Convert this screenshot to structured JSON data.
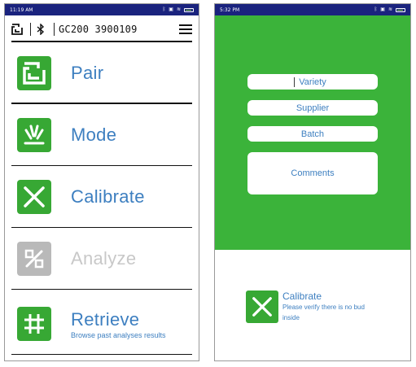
{
  "left_phone": {
    "status_bar": {
      "time": "11:19 AM"
    },
    "header": {
      "device_label": "GC200 3900109"
    },
    "menu": [
      {
        "label": "Pair",
        "icon": "pair-icon",
        "enabled": true,
        "subtitle": ""
      },
      {
        "label": "Mode",
        "icon": "mode-icon",
        "enabled": true,
        "subtitle": ""
      },
      {
        "label": "Calibrate",
        "icon": "calibrate-icon",
        "enabled": true,
        "subtitle": ""
      },
      {
        "label": "Analyze",
        "icon": "analyze-icon",
        "enabled": false,
        "subtitle": ""
      },
      {
        "label": "Retrieve",
        "icon": "retrieve-icon",
        "enabled": true,
        "subtitle": "Browse past analyses results"
      }
    ]
  },
  "right_phone": {
    "status_bar": {
      "time": "5:32 PM"
    },
    "form": {
      "variety": "Variety",
      "supplier": "Supplier",
      "batch": "Batch",
      "comments": "Comments"
    },
    "calibrate": {
      "title": "Calibrate",
      "description": "Please verify there is no bud inside"
    }
  },
  "colors": {
    "status_bar": "#1a237e",
    "accent_green": "#37a834",
    "panel_green": "#3bb33a",
    "text_blue": "#3d7fc0",
    "disabled_gray": "#b9b9b9"
  }
}
